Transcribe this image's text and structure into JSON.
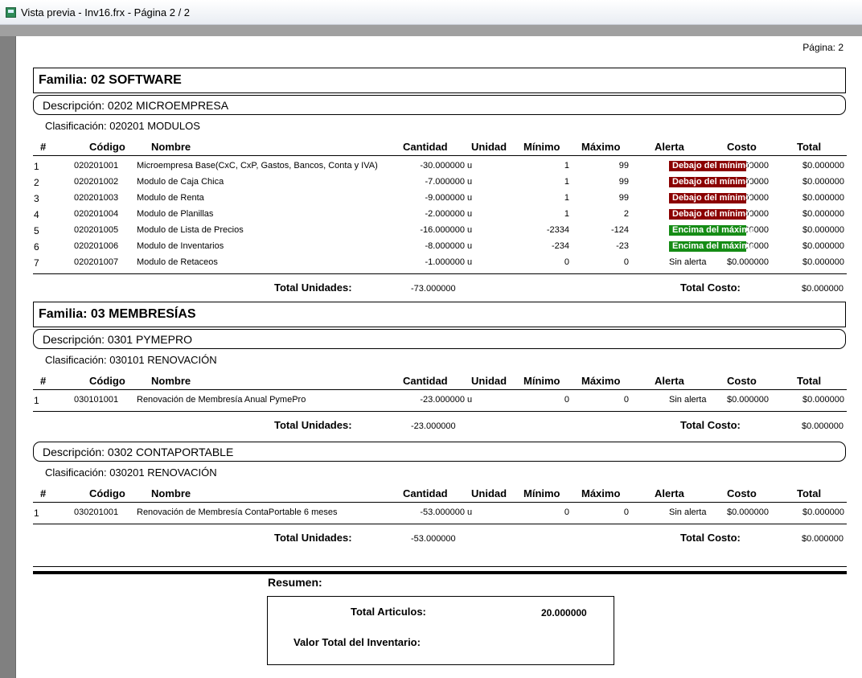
{
  "window": {
    "title": "Vista previa - Inv16.frx - Página 2 / 2"
  },
  "report": {
    "page_label": "Página: 2",
    "columns": {
      "num": "#",
      "code": "Código",
      "name": "Nombre",
      "qty": "Cantidad",
      "unit": "Unidad",
      "min": "Mínimo",
      "max": "Máximo",
      "alert": "Alerta",
      "cost": "Costo",
      "total": "Total"
    },
    "labels": {
      "total_units": "Total Unidades:",
      "total_cost": "Total Costo:"
    },
    "families": [
      {
        "title": "Familia: 02 SOFTWARE",
        "descriptions": [
          {
            "title": "Descripción: 0202   MICROEMPRESA",
            "classification": "Clasificación: 020201   MODULOS",
            "rows": [
              {
                "num": "1",
                "code": "020201001",
                "name": "Microempresa Base(CxC, CxP, Gastos, Bancos, Conta y IVA)",
                "qty": "-30.000000",
                "unit": "u",
                "min": "1",
                "max": "99",
                "alert": "Debajo del mínimo",
                "alert_type": "low",
                "cost": "$0.000000",
                "total": "$0.000000"
              },
              {
                "num": "2",
                "code": "020201002",
                "name": "Modulo de Caja Chica",
                "qty": "-7.000000",
                "unit": "u",
                "min": "1",
                "max": "99",
                "alert": "Debajo del mínimo",
                "alert_type": "low",
                "cost": "$0.000000",
                "total": "$0.000000"
              },
              {
                "num": "3",
                "code": "020201003",
                "name": "Modulo de Renta",
                "qty": "-9.000000",
                "unit": "u",
                "min": "1",
                "max": "99",
                "alert": "Debajo del mínimo",
                "alert_type": "low",
                "cost": "$0.000000",
                "total": "$0.000000"
              },
              {
                "num": "4",
                "code": "020201004",
                "name": "Modulo de Planillas",
                "qty": "-2.000000",
                "unit": "u",
                "min": "1",
                "max": "2",
                "alert": "Debajo del mínimo",
                "alert_type": "low",
                "cost": "$0.000000",
                "total": "$0.000000"
              },
              {
                "num": "5",
                "code": "020201005",
                "name": "Modulo de Lista de Precios",
                "qty": "-16.000000",
                "unit": "u",
                "min": "-2334",
                "max": "-124",
                "alert": "Encima del máximo",
                "alert_type": "high",
                "cost": "$0.000000",
                "total": "$0.000000"
              },
              {
                "num": "6",
                "code": "020201006",
                "name": "Modulo de Inventarios",
                "qty": "-8.000000",
                "unit": "u",
                "min": "-234",
                "max": "-23",
                "alert": "Encima del máximo",
                "alert_type": "high",
                "cost": "$0.000000",
                "total": "$0.000000"
              },
              {
                "num": "7",
                "code": "020201007",
                "name": "Modulo de Retaceos",
                "qty": "-1.000000",
                "unit": "u",
                "min": "0",
                "max": "0",
                "alert": "Sin alerta",
                "alert_type": "none",
                "cost": "$0.000000",
                "total": "$0.000000"
              }
            ],
            "total_units": "-73.000000",
            "total_cost": "$0.000000"
          }
        ]
      },
      {
        "title": "Familia: 03 MEMBRESÍAS",
        "descriptions": [
          {
            "title": "Descripción: 0301   PYMEPRO",
            "classification": "Clasificación: 030101   RENOVACIÓN",
            "rows": [
              {
                "num": "1",
                "code": "030101001",
                "name": "Renovación de Membresía Anual PymePro",
                "qty": "-23.000000",
                "unit": "u",
                "min": "0",
                "max": "0",
                "alert": "Sin alerta",
                "alert_type": "none",
                "cost": "$0.000000",
                "total": "$0.000000"
              }
            ],
            "total_units": "-23.000000",
            "total_cost": "$0.000000"
          },
          {
            "title": "Descripción: 0302   CONTAPORTABLE",
            "classification": "Clasificación: 030201   RENOVACIÓN",
            "rows": [
              {
                "num": "1",
                "code": "030201001",
                "name": "Renovación de Membresía ContaPortable 6 meses",
                "qty": "-53.000000",
                "unit": "u",
                "min": "0",
                "max": "0",
                "alert": "Sin alerta",
                "alert_type": "none",
                "cost": "$0.000000",
                "total": "$0.000000"
              }
            ],
            "total_units": "-53.000000",
            "total_cost": "$0.000000"
          }
        ]
      }
    ],
    "summary": {
      "title": "Resumen:",
      "total_articles_label": "Total Articulos:",
      "total_articles_value": "20.000000",
      "inventory_value_label": "Valor Total del Inventario:"
    }
  }
}
